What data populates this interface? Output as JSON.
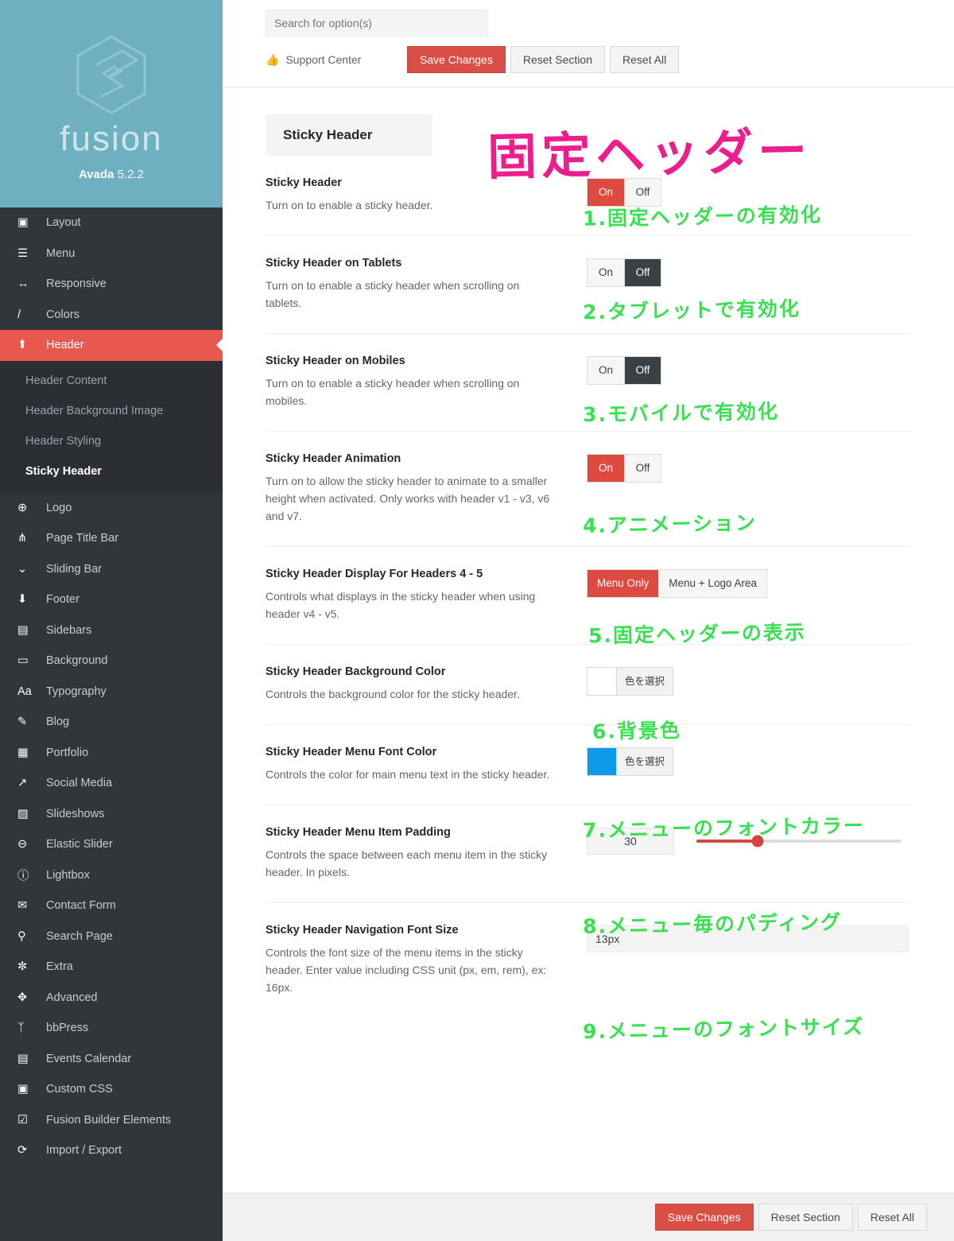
{
  "brand": {
    "wordmark": "fusion",
    "product": "Avada",
    "version": "5.2.2"
  },
  "sidebar": {
    "items": [
      {
        "label": "Layout",
        "icon": "layout-icon"
      },
      {
        "label": "Menu",
        "icon": "hamburger-icon"
      },
      {
        "label": "Responsive",
        "icon": "arrows-horizontal-icon"
      },
      {
        "label": "Colors",
        "icon": "brush-icon"
      },
      {
        "label": "Header",
        "icon": "arrow-up-icon",
        "active": true
      }
    ],
    "subitems": [
      {
        "label": "Header Content"
      },
      {
        "label": "Header Background Image"
      },
      {
        "label": "Header Styling"
      },
      {
        "label": "Sticky Header",
        "current": true
      }
    ],
    "items_after": [
      {
        "label": "Logo",
        "icon": "plus-circle-icon"
      },
      {
        "label": "Page Title Bar",
        "icon": "sliders-icon"
      },
      {
        "label": "Sliding Bar",
        "icon": "chevron-down-icon"
      },
      {
        "label": "Footer",
        "icon": "arrow-down-icon"
      },
      {
        "label": "Sidebars",
        "icon": "sidebar-icon"
      },
      {
        "label": "Background",
        "icon": "window-icon"
      },
      {
        "label": "Typography",
        "icon": "aa-icon"
      },
      {
        "label": "Blog",
        "icon": "pencil-doc-icon"
      },
      {
        "label": "Portfolio",
        "icon": "grid-icon"
      },
      {
        "label": "Social Media",
        "icon": "share-arrow-icon"
      },
      {
        "label": "Slideshows",
        "icon": "image-icon"
      },
      {
        "label": "Elastic Slider",
        "icon": "minus-circle-icon"
      },
      {
        "label": "Lightbox",
        "icon": "info-circle-icon"
      },
      {
        "label": "Contact Form",
        "icon": "envelope-icon"
      },
      {
        "label": "Search Page",
        "icon": "magnifier-icon"
      },
      {
        "label": "Extra",
        "icon": "gears-icon"
      },
      {
        "label": "Advanced",
        "icon": "puzzle-icon"
      },
      {
        "label": "bbPress",
        "icon": "person-icon"
      },
      {
        "label": "Events Calendar",
        "icon": "calendar-icon"
      },
      {
        "label": "Custom CSS",
        "icon": "code-window-icon"
      },
      {
        "label": "Fusion Builder Elements",
        "icon": "checkbox-icon"
      },
      {
        "label": "Import / Export",
        "icon": "refresh-icon"
      }
    ]
  },
  "topbar": {
    "search_placeholder": "Search for option(s)",
    "support_label": "Support Center",
    "save_label": "Save Changes",
    "reset_section_label": "Reset Section",
    "reset_all_label": "Reset All"
  },
  "annotations": {
    "title": "固定ヘッダー",
    "a1": "1.固定ヘッダーの有効化",
    "a2": "2.タブレットで有効化",
    "a3": "3.モバイルで有効化",
    "a4": "4.アニメーション",
    "a5": "5.固定ヘッダーの表示",
    "a6": "6.背景色",
    "a7": "7.メニューのフォントカラー",
    "a8": "8.メニュー毎のパディング",
    "a9": "9.メニューのフォントサイズ"
  },
  "content": {
    "section_title": "Sticky Header",
    "rows": [
      {
        "title": "Sticky Header",
        "desc": "Turn on to enable a sticky header.",
        "control": "toggle",
        "options": [
          "On",
          "Off"
        ],
        "selected": "On"
      },
      {
        "title": "Sticky Header on Tablets",
        "desc": "Turn on to enable a sticky header when scrolling on tablets.",
        "control": "toggle",
        "options": [
          "On",
          "Off"
        ],
        "selected": "Off"
      },
      {
        "title": "Sticky Header on Mobiles",
        "desc": "Turn on to enable a sticky header when scrolling on mobiles.",
        "control": "toggle",
        "options": [
          "On",
          "Off"
        ],
        "selected": "Off"
      },
      {
        "title": "Sticky Header Animation",
        "desc": "Turn on to allow the sticky header to animate to a smaller height when activated. Only works with header v1 - v3, v6 and v7.",
        "control": "toggle",
        "options": [
          "On",
          "Off"
        ],
        "selected": "On"
      },
      {
        "title": "Sticky Header Display For Headers 4 - 5",
        "desc": "Controls what displays in the sticky header when using header v4 - v5.",
        "control": "toggle",
        "options": [
          "Menu Only",
          "Menu + Logo Area"
        ],
        "selected": "Menu Only"
      },
      {
        "title": "Sticky Header Background Color",
        "desc": "Controls the background color for the sticky header.",
        "control": "color",
        "swatch": "#ffffff",
        "pick_label": "色を選択"
      },
      {
        "title": "Sticky Header Menu Font Color",
        "desc": "Controls the color for main menu text in the sticky header.",
        "control": "color",
        "swatch": "#0d9ae8",
        "pick_label": "色を選択"
      },
      {
        "title": "Sticky Header Menu Item Padding",
        "desc": "Controls the space between each menu item in the sticky header. In pixels.",
        "control": "slider",
        "value": "30",
        "percent": 30
      },
      {
        "title": "Sticky Header Navigation Font Size",
        "desc": "Controls the font size of the menu items in the sticky header. Enter value including CSS unit (px, em, rem), ex: 16px.",
        "control": "text",
        "value": "13px"
      }
    ]
  },
  "footer": {
    "save_label": "Save Changes",
    "reset_section_label": "Reset Section",
    "reset_all_label": "Reset All"
  },
  "colors": {
    "brand_teal": "#6eafc0",
    "sidebar_dark": "#31363b",
    "accent_red": "#dd4a40",
    "annotation_pink": "#ec1e8c",
    "annotation_green": "#3ae052"
  }
}
